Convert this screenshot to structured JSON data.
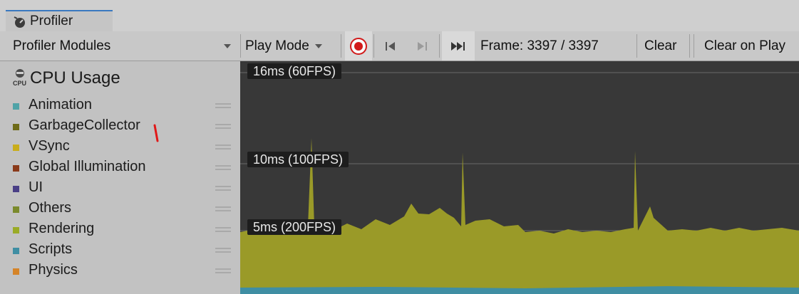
{
  "window": {
    "tab_title": "Profiler",
    "tab_icon": "profiler-icon"
  },
  "toolbar": {
    "modules_dropdown": "Profiler Modules",
    "play_mode": "Play Mode",
    "frame_label": "Frame: 3397 / 3397",
    "clear": "Clear",
    "clear_on_play": "Clear on Play",
    "icons": [
      "record-icon",
      "step-back-icon",
      "step-forward-icon",
      "jump-current-frame-icon"
    ],
    "record_color": "#d11a1a"
  },
  "module": {
    "title": "CPU Usage",
    "icon": "cpu-icon",
    "categories": [
      {
        "label": "Animation",
        "color": "#4fa3a7"
      },
      {
        "label": "GarbageCollector",
        "color": "#6e6b18"
      },
      {
        "label": "VSync",
        "color": "#c9ad1c"
      },
      {
        "label": "Global Illumination",
        "color": "#8a3a1a"
      },
      {
        "label": "UI",
        "color": "#4a3f86"
      },
      {
        "label": "Others",
        "color": "#7b8a2c"
      },
      {
        "label": "Rendering",
        "color": "#9aab26"
      },
      {
        "label": "Scripts",
        "color": "#3f8ea3"
      },
      {
        "label": "Physics",
        "color": "#d58428"
      }
    ]
  },
  "graph": {
    "threshold_labels": [
      "16ms (60FPS)",
      "10ms (100FPS)",
      "5ms (200FPS)"
    ],
    "fill_color": "#9a9a28",
    "baseline_color": "#3f8ea3"
  }
}
